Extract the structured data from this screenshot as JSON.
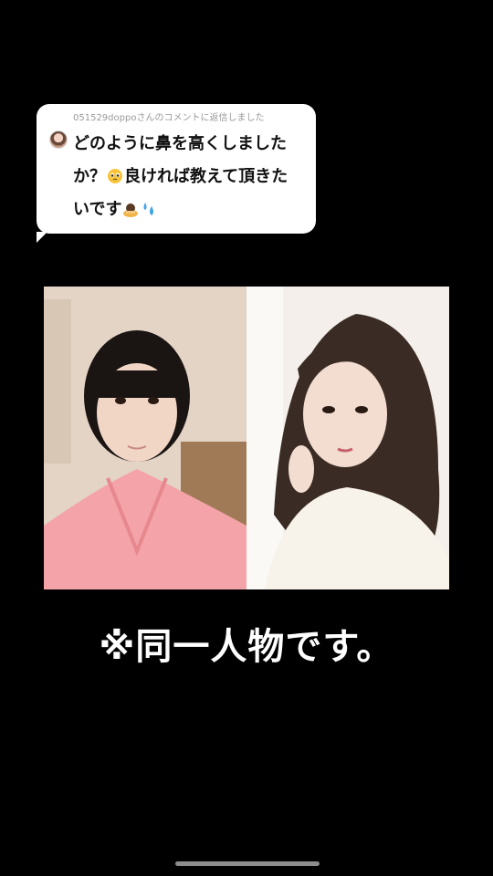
{
  "reply": {
    "header": "051529doppoさんのコメントに返信しました",
    "line1": "どのように鼻を高くしました",
    "line2_a": "か？",
    "line2_b": "良ければ教えて頂きた",
    "line3": "いです",
    "emojis": [
      "pleading-face",
      "bowing-person",
      "sweat-droplets"
    ]
  },
  "caption": "※同一人物です。"
}
